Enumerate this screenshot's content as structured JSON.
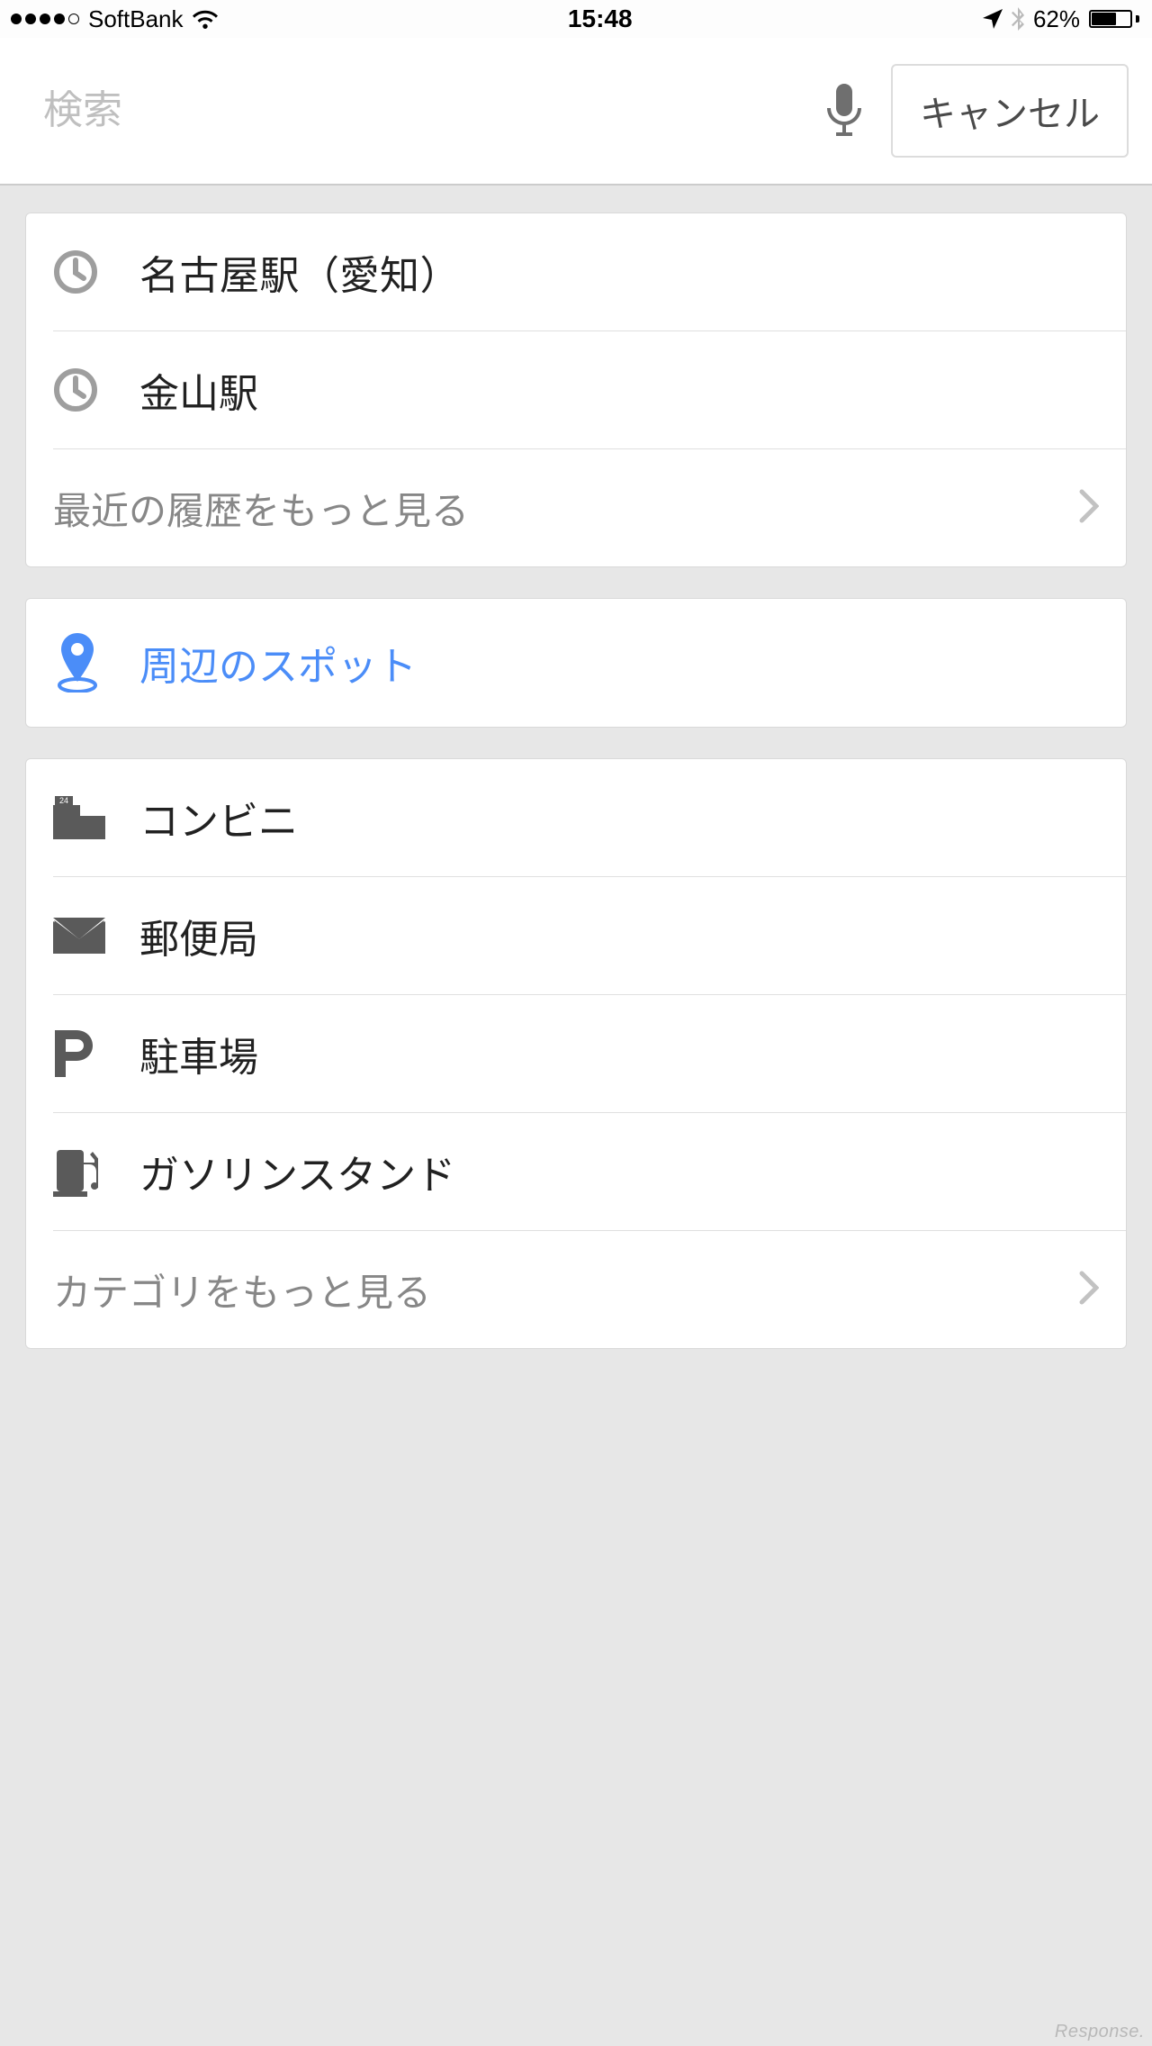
{
  "status": {
    "carrier": "SoftBank",
    "time": "15:48",
    "battery_pct": "62%",
    "battery_fill": 62
  },
  "search": {
    "placeholder": "検索",
    "cancel_label": "キャンセル"
  },
  "recent": {
    "items": [
      {
        "label": "名古屋駅（愛知）"
      },
      {
        "label": "金山駅"
      }
    ],
    "more_label": "最近の履歴をもっと見る"
  },
  "nearby": {
    "label": "周辺のスポット"
  },
  "categories": {
    "items": [
      {
        "id": "convenience-store",
        "label": "コンビニ"
      },
      {
        "id": "post-office",
        "label": "郵便局"
      },
      {
        "id": "parking",
        "label": "駐車場"
      },
      {
        "id": "gas-station",
        "label": "ガソリンスタンド"
      }
    ],
    "more_label": "カテゴリをもっと見る"
  },
  "watermark": "Response."
}
